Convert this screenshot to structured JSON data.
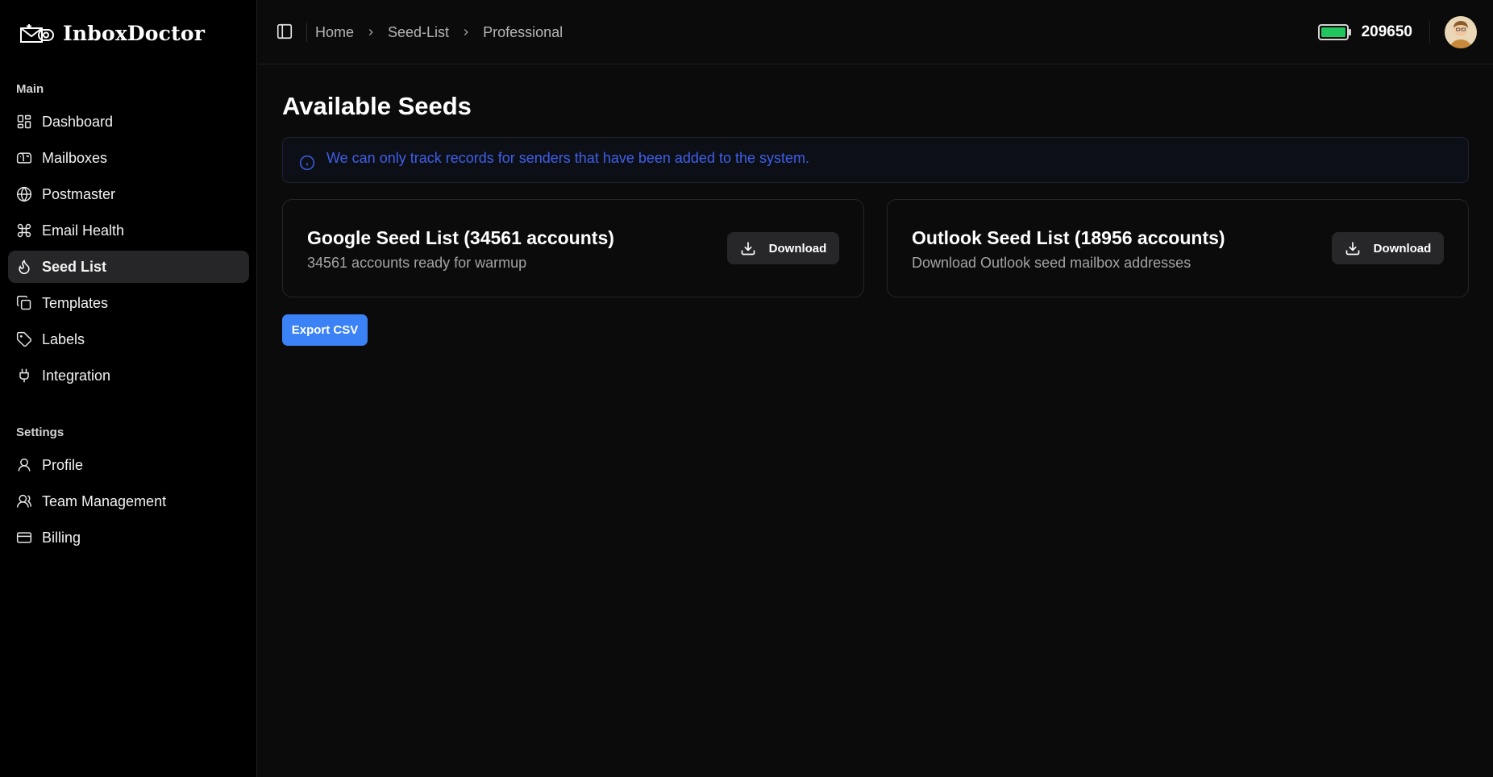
{
  "brand": {
    "name": "InboxDoctor"
  },
  "sidebar": {
    "sections": [
      {
        "title": "Main",
        "items": [
          {
            "label": "Dashboard",
            "icon": "dashboard-icon"
          },
          {
            "label": "Mailboxes",
            "icon": "mailbox-icon"
          },
          {
            "label": "Postmaster",
            "icon": "globe-icon"
          },
          {
            "label": "Email Health",
            "icon": "command-icon"
          },
          {
            "label": "Seed List",
            "icon": "flame-icon",
            "active": true
          },
          {
            "label": "Templates",
            "icon": "copy-icon"
          },
          {
            "label": "Labels",
            "icon": "tag-icon"
          },
          {
            "label": "Integration",
            "icon": "plug-icon"
          }
        ]
      },
      {
        "title": "Settings",
        "items": [
          {
            "label": "Profile",
            "icon": "user-icon"
          },
          {
            "label": "Team Management",
            "icon": "users-icon"
          },
          {
            "label": "Billing",
            "icon": "credit-card-icon"
          }
        ]
      }
    ]
  },
  "header": {
    "breadcrumb": [
      "Home",
      "Seed-List",
      "Professional"
    ],
    "credits": "209650",
    "credit_icon": "battery-icon"
  },
  "main": {
    "title": "Available Seeds",
    "alert": "We can only track records for senders that have been added to the system.",
    "cards": [
      {
        "title": "Google Seed List (34561 accounts)",
        "description": "34561 accounts ready for warmup",
        "button": "Download"
      },
      {
        "title": "Outlook Seed List (18956 accounts)",
        "description": "Download Outlook seed mailbox addresses",
        "button": "Download"
      }
    ],
    "export_button": "Export CSV"
  },
  "colors": {
    "accent": "#3b82f6",
    "alert_text": "#3f5fe8",
    "battery": "#22c55e",
    "active_nav": "#262628"
  }
}
